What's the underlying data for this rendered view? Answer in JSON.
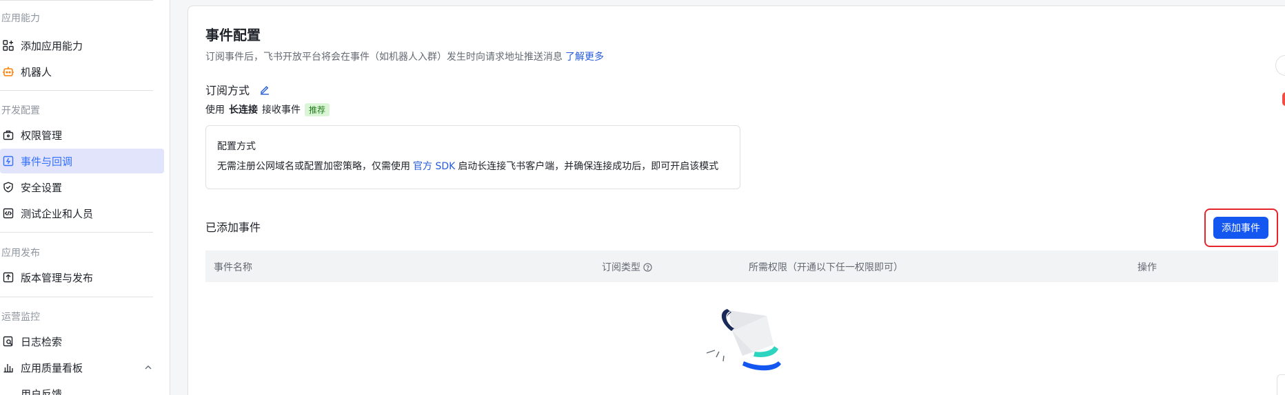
{
  "sidebar": {
    "groups": [
      {
        "title": "应用能力"
      },
      {
        "title": "开发配置"
      },
      {
        "title": "应用发布"
      },
      {
        "title": "运营监控"
      }
    ],
    "items": [
      {
        "label": "添加应用能力",
        "icon": "add-grid-icon"
      },
      {
        "label": "机器人",
        "icon": "robot-icon"
      },
      {
        "label": "权限管理",
        "icon": "permission-icon"
      },
      {
        "label": "事件与回调",
        "icon": "event-icon",
        "active": true
      },
      {
        "label": "安全设置",
        "icon": "shield-icon"
      },
      {
        "label": "测试企业和人员",
        "icon": "code-icon"
      },
      {
        "label": "版本管理与发布",
        "icon": "upload-icon"
      },
      {
        "label": "日志检索",
        "icon": "log-search-icon"
      },
      {
        "label": "应用质量看板",
        "icon": "bar-chart-icon"
      },
      {
        "label": "用户反馈",
        "icon": "feedback-icon"
      }
    ]
  },
  "main": {
    "title": "事件配置",
    "subtitle": "订阅事件后，飞书开放平台将会在事件（如机器人入群）发生时向请求地址推送消息",
    "learn_more": "了解更多",
    "subscription": {
      "heading": "订阅方式",
      "prefix": "使用",
      "method": "长连接",
      "suffix": "接收事件",
      "tag": "推荐"
    },
    "config_box": {
      "heading": "配置方式",
      "text_before": "无需注册公网域名或配置加密策略，仅需使用",
      "link": "官方 SDK",
      "text_after": "启动长连接飞书客户端，并确保连接成功后，即可开启该模式"
    },
    "added_events": {
      "heading": "已添加事件",
      "add_button": "添加事件",
      "columns": [
        "事件名称",
        "订阅类型",
        "所需权限（开通以下任一权限即可）",
        "操作"
      ]
    }
  },
  "colors": {
    "accent": "#1456f0",
    "link": "#245bdb",
    "active_bg": "#e1e4fb",
    "highlight_border": "#e6242b",
    "tag_bg": "#d9f5d6",
    "tag_text": "#237b19"
  }
}
